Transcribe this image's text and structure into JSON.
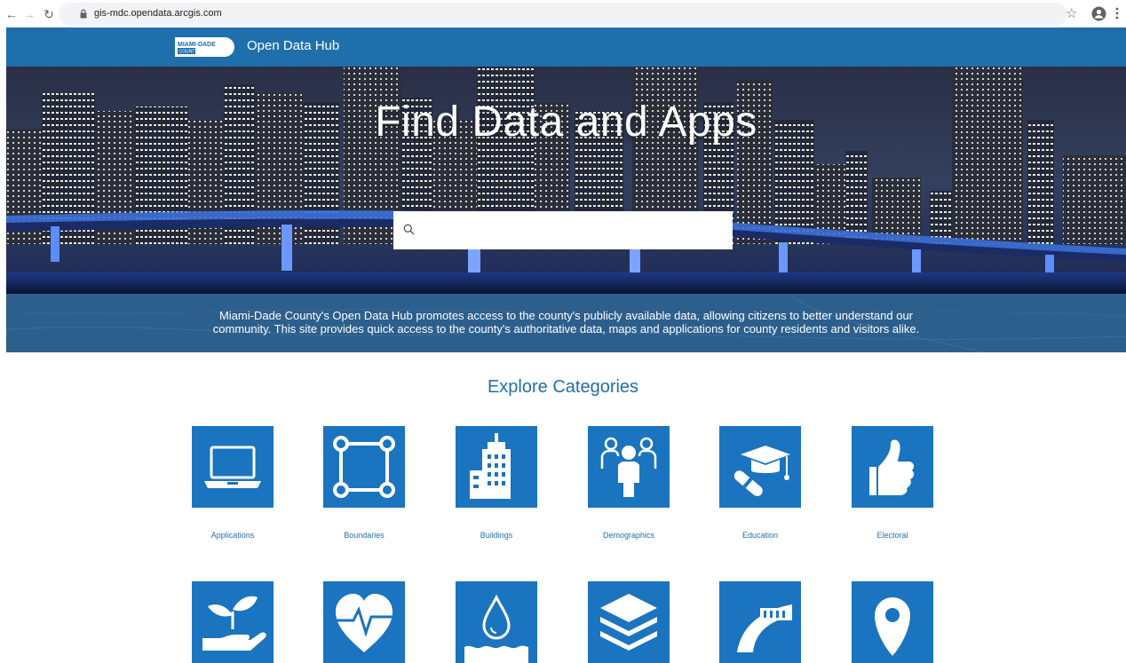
{
  "browser": {
    "url": "gis-mdc.opendata.arcgis.com",
    "back_icon": "arrow-left-icon",
    "forward_icon": "arrow-right-icon",
    "reload_icon": "reload-icon",
    "star_icon": "star-icon",
    "account_icon": "account-icon",
    "menu_icon": "more-vertical-icon"
  },
  "header": {
    "logo_line1": "MIAMI-DADE",
    "logo_line2": "COUNTY",
    "title": "Open Data Hub",
    "color": "#1f6fad"
  },
  "hero": {
    "title": "Find Data and Apps",
    "search_placeholder": "",
    "search_value": ""
  },
  "description": {
    "line1": "Miami-Dade County's Open Data Hub promotes access to the county's publicly available data, allowing citizens to better understand our",
    "line2": "community. This site provides quick access to the county's authoritative data, maps and applications for county residents and visitors alike."
  },
  "categories": {
    "title": "Explore Categories",
    "tile_color": "#1a74bf",
    "row1": [
      {
        "label": "Applications",
        "icon": "laptop-icon"
      },
      {
        "label": "Boundaries",
        "icon": "boundary-square-icon"
      },
      {
        "label": "Buildings",
        "icon": "building-icon"
      },
      {
        "label": "Demographics",
        "icon": "people-icon"
      },
      {
        "label": "Education",
        "icon": "graduation-cap-icon"
      },
      {
        "label": "Electoral",
        "icon": "thumbs-up-icon"
      }
    ],
    "row2": [
      {
        "label": "",
        "icon": "plant-in-hand-icon"
      },
      {
        "label": "",
        "icon": "heart-pulse-icon"
      },
      {
        "label": "",
        "icon": "water-drop-icon"
      },
      {
        "label": "",
        "icon": "layers-icon"
      },
      {
        "label": "",
        "icon": "road-icon"
      },
      {
        "label": "",
        "icon": "map-pin-icon"
      }
    ]
  }
}
